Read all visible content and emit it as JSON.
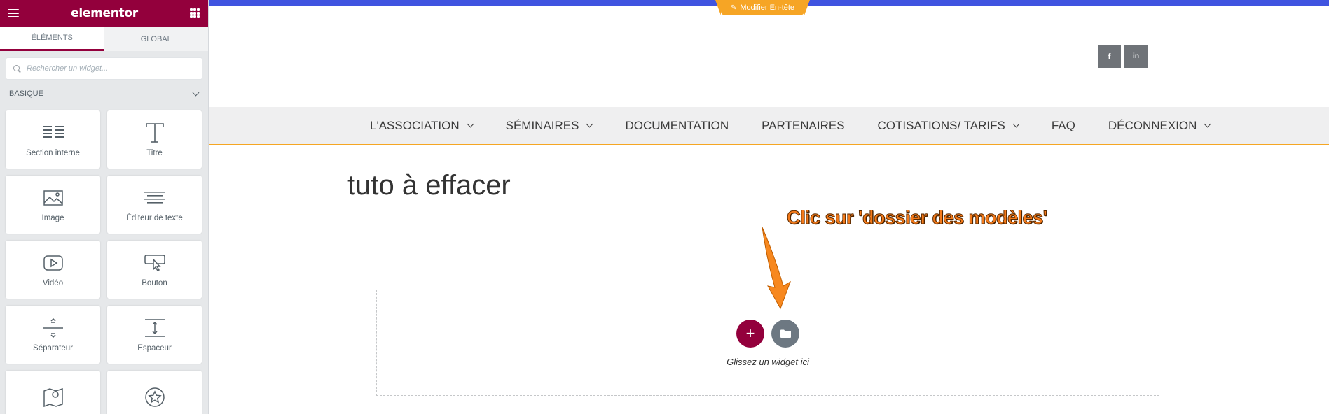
{
  "panel": {
    "logo": "elementor",
    "tabs": [
      {
        "label": "ÉLÉMENTS",
        "active": true
      },
      {
        "label": "GLOBAL",
        "active": false
      }
    ],
    "search": {
      "placeholder": "Rechercher un widget..."
    },
    "category": {
      "label": "BASIQUE"
    },
    "widgets": [
      {
        "label": "Section interne",
        "icon": "inner-section-icon"
      },
      {
        "label": "Titre",
        "icon": "heading-icon"
      },
      {
        "label": "Image",
        "icon": "image-icon"
      },
      {
        "label": "Éditeur de texte",
        "icon": "text-editor-icon"
      },
      {
        "label": "Vidéo",
        "icon": "video-icon"
      },
      {
        "label": "Bouton",
        "icon": "button-icon"
      },
      {
        "label": "Séparateur",
        "icon": "divider-icon"
      },
      {
        "label": "Espaceur",
        "icon": "spacer-icon"
      },
      {
        "label": "",
        "icon": "google-maps-icon"
      },
      {
        "label": "",
        "icon": "star-icon"
      }
    ],
    "accent_color": "#93003c"
  },
  "preview": {
    "edit_header_label": "Modifier En-tête",
    "social": [
      {
        "icon": "facebook-icon",
        "glyph": "f"
      },
      {
        "icon": "linkedin-icon",
        "glyph": "in"
      }
    ],
    "nav": [
      {
        "label": "L'ASSOCIATION",
        "dropdown": true
      },
      {
        "label": "SÉMINAIRES",
        "dropdown": true
      },
      {
        "label": "DOCUMENTATION",
        "dropdown": false
      },
      {
        "label": "PARTENAIRES",
        "dropdown": false
      },
      {
        "label": "COTISATIONS/ TARIFS",
        "dropdown": true
      },
      {
        "label": "FAQ",
        "dropdown": false
      },
      {
        "label": "DÉCONNEXION",
        "dropdown": true
      }
    ],
    "page_title": "tuto à effacer",
    "annotation": "Clic sur 'dossier des modèles'",
    "drop_zone": {
      "add_glyph": "+",
      "hint": "Glissez un widget ici"
    }
  }
}
